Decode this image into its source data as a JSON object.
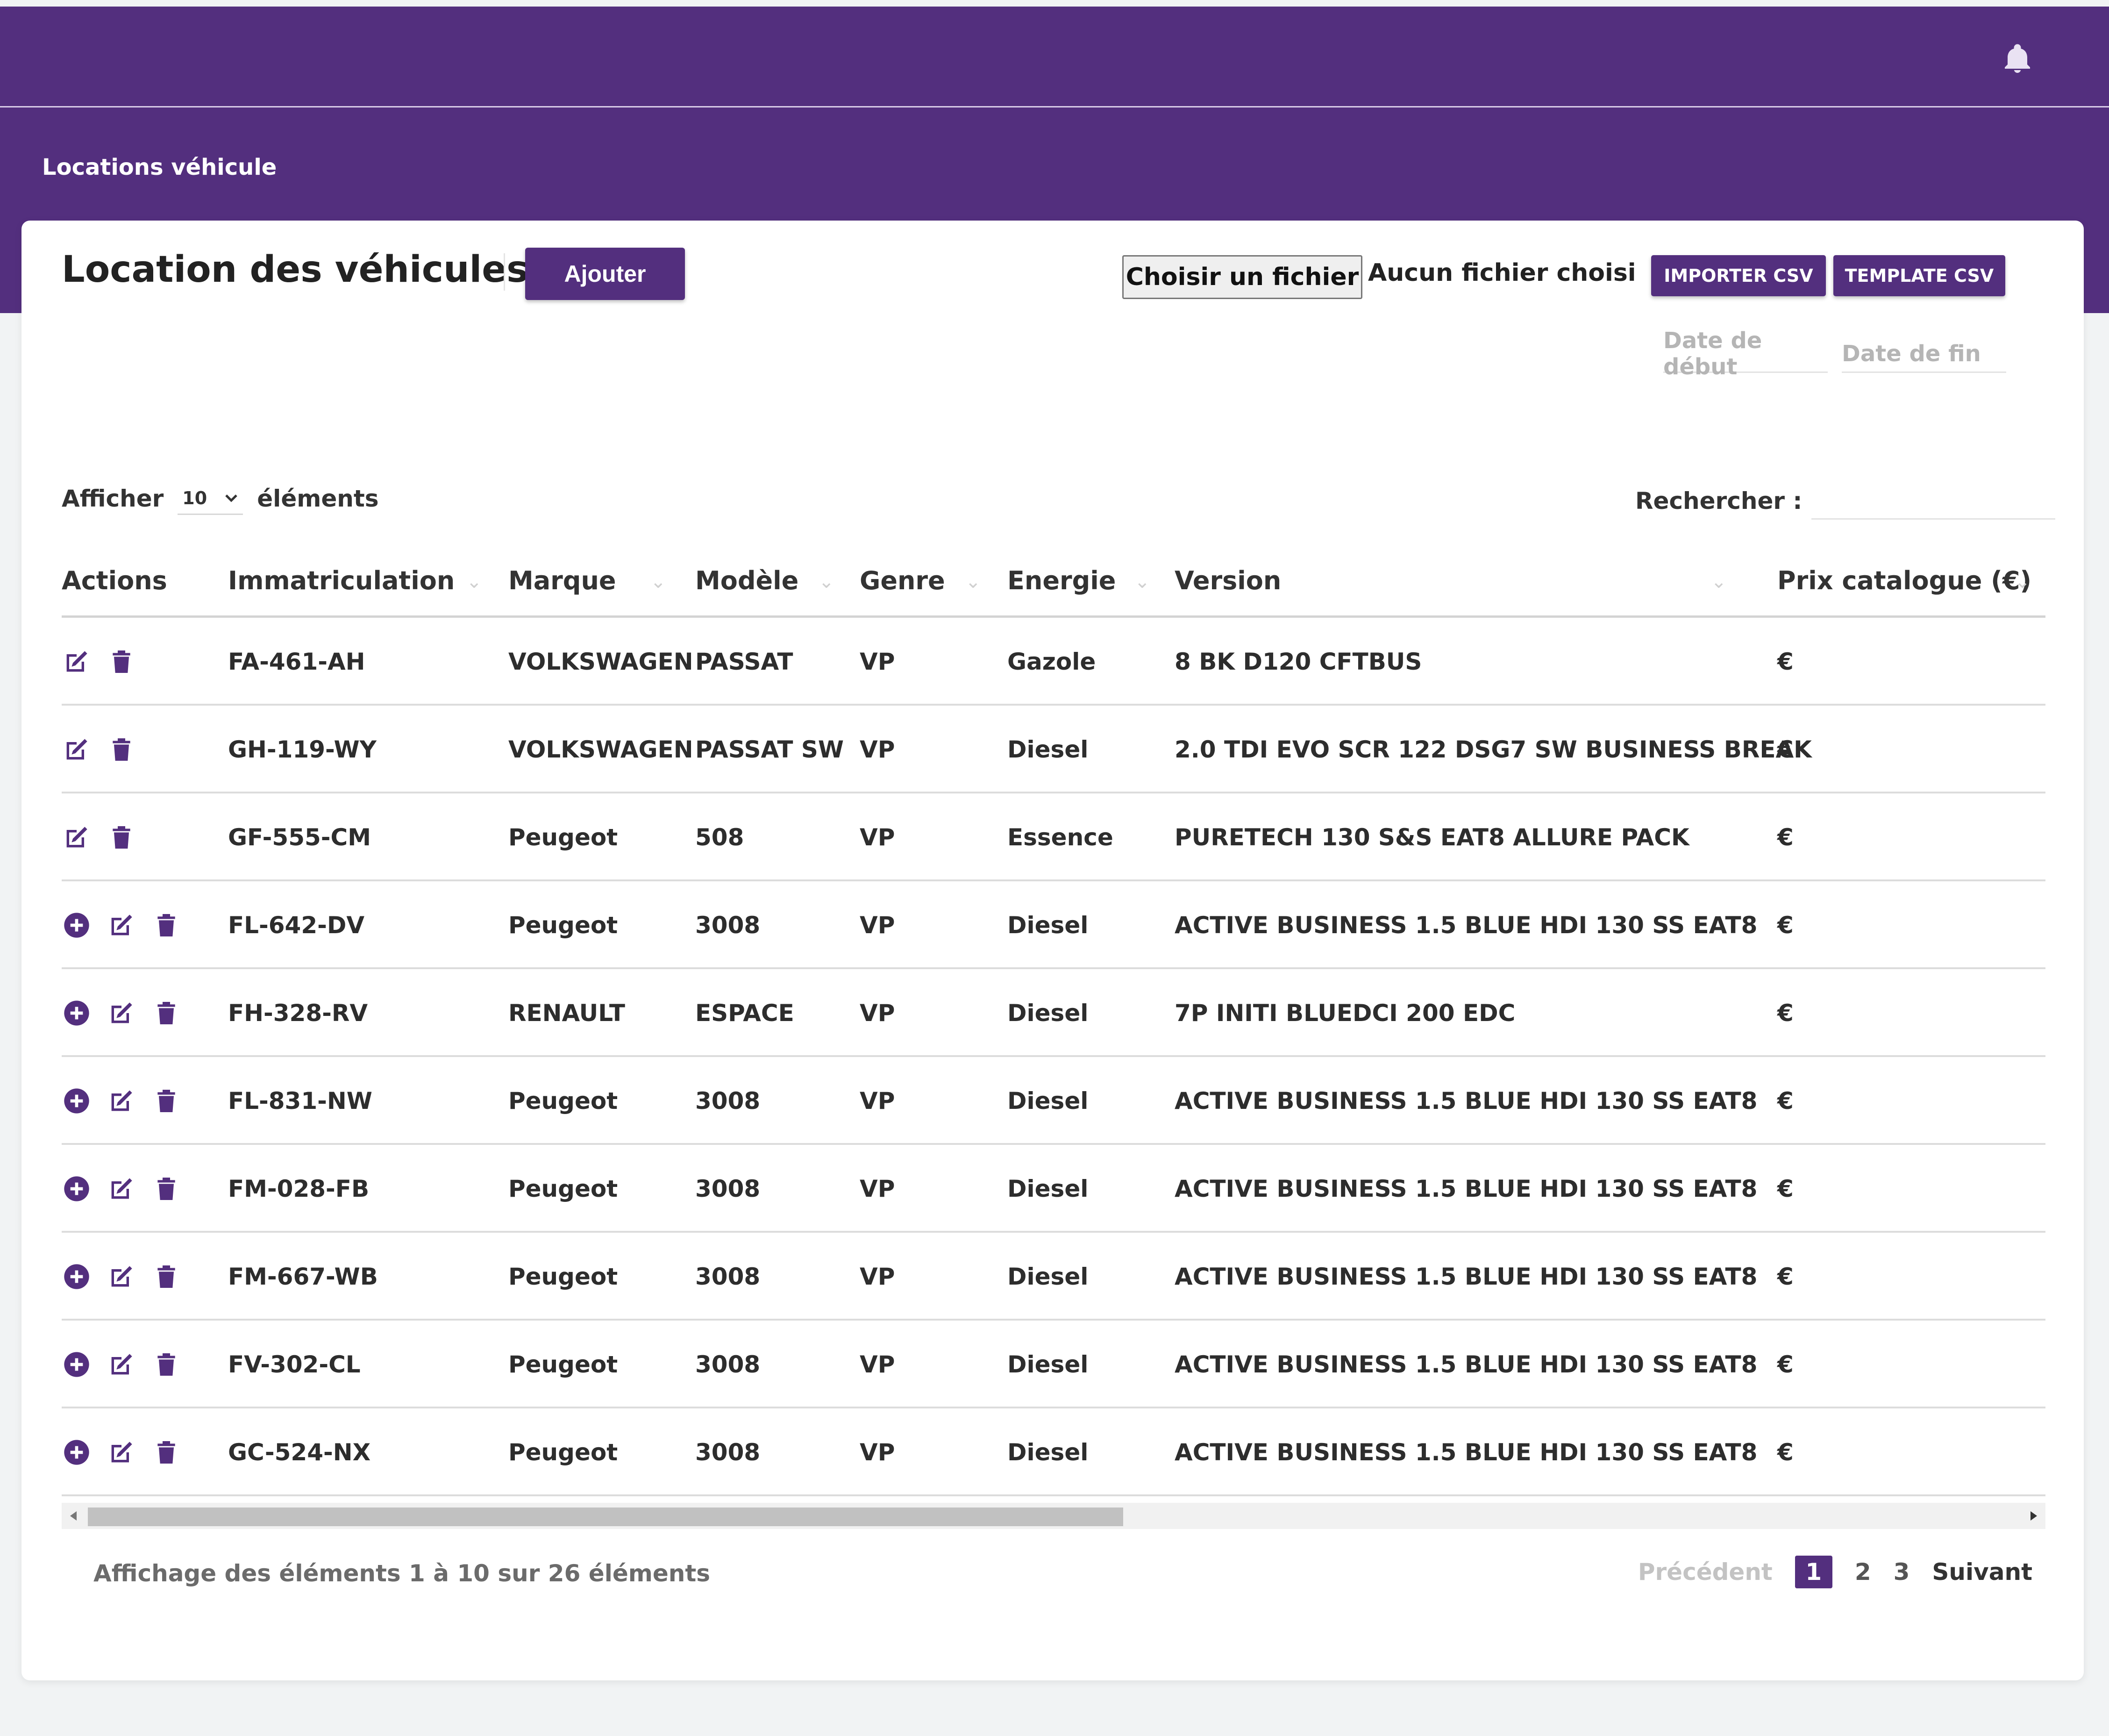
{
  "colors": {
    "primary": "#532f7e",
    "background": "#f1f3f4"
  },
  "topbar": {
    "bell_icon": "bell-icon"
  },
  "breadcrumb": "Locations véhicule",
  "card": {
    "title": "Location des véhicules",
    "add_label": "Ajouter",
    "file_button": "Choisir un fichier",
    "file_status": "Aucun fichier choisi",
    "import_label": "IMPORTER CSV",
    "template_label": "TEMPLATE CSV",
    "date_start_placeholder": "Date de début",
    "date_end_placeholder": "Date de fin"
  },
  "list_controls": {
    "show_label": "Afficher",
    "page_size": "10",
    "elements_label": "éléments",
    "search_label": "Rechercher :"
  },
  "table": {
    "headers": [
      "Actions",
      "Immatriculation",
      "Marque",
      "Modèle",
      "Genre",
      "Energie",
      "Version",
      "Prix catalogue (€)"
    ],
    "rows": [
      {
        "plus": false,
        "immatriculation": "FA-461-AH",
        "marque": "VOLKSWAGEN",
        "modele": "PASSAT",
        "genre": "VP",
        "energie": "Gazole",
        "version": "8 BK D120 CFTBUS",
        "prix": "€"
      },
      {
        "plus": false,
        "immatriculation": "GH-119-WY",
        "marque": "VOLKSWAGEN",
        "modele": "PASSAT SW",
        "genre": "VP",
        "energie": "Diesel",
        "version": "2.0 TDI EVO SCR 122 DSG7 SW BUSINESS BREAK",
        "prix": "€"
      },
      {
        "plus": false,
        "immatriculation": "GF-555-CM",
        "marque": "Peugeot",
        "modele": "508",
        "genre": "VP",
        "energie": "Essence",
        "version": "PURETECH 130 S&S EAT8 ALLURE PACK",
        "prix": "€"
      },
      {
        "plus": true,
        "immatriculation": "FL-642-DV",
        "marque": "Peugeot",
        "modele": "3008",
        "genre": "VP",
        "energie": "Diesel",
        "version": "ACTIVE BUSINESS 1.5 BLUE HDI 130 SS EAT8",
        "prix": "€"
      },
      {
        "plus": true,
        "immatriculation": "FH-328-RV",
        "marque": "RENAULT",
        "modele": "ESPACE",
        "genre": "VP",
        "energie": "Diesel",
        "version": "7P INITI BLUEDCI 200 EDC",
        "prix": "€"
      },
      {
        "plus": true,
        "immatriculation": "FL-831-NW",
        "marque": "Peugeot",
        "modele": "3008",
        "genre": "VP",
        "energie": "Diesel",
        "version": "ACTIVE BUSINESS 1.5 BLUE HDI 130 SS EAT8",
        "prix": "€"
      },
      {
        "plus": true,
        "immatriculation": "FM-028-FB",
        "marque": "Peugeot",
        "modele": "3008",
        "genre": "VP",
        "energie": "Diesel",
        "version": "ACTIVE BUSINESS 1.5 BLUE HDI 130 SS EAT8",
        "prix": "€"
      },
      {
        "plus": true,
        "immatriculation": "FM-667-WB",
        "marque": "Peugeot",
        "modele": "3008",
        "genre": "VP",
        "energie": "Diesel",
        "version": "ACTIVE BUSINESS 1.5 BLUE HDI 130 SS EAT8",
        "prix": "€"
      },
      {
        "plus": true,
        "immatriculation": "FV-302-CL",
        "marque": "Peugeot",
        "modele": "3008",
        "genre": "VP",
        "energie": "Diesel",
        "version": "ACTIVE BUSINESS 1.5 BLUE HDI 130 SS EAT8",
        "prix": "€"
      },
      {
        "plus": true,
        "immatriculation": "GC-524-NX",
        "marque": "Peugeot",
        "modele": "3008",
        "genre": "VP",
        "energie": "Diesel",
        "version": "ACTIVE BUSINESS 1.5 BLUE HDI 130 SS EAT8",
        "prix": "€"
      }
    ]
  },
  "footer": {
    "info": "Affichage des éléments 1 à 10 sur 26 éléments",
    "prev": "Précédent",
    "pages": [
      "1",
      "2",
      "3"
    ],
    "next": "Suivant"
  }
}
